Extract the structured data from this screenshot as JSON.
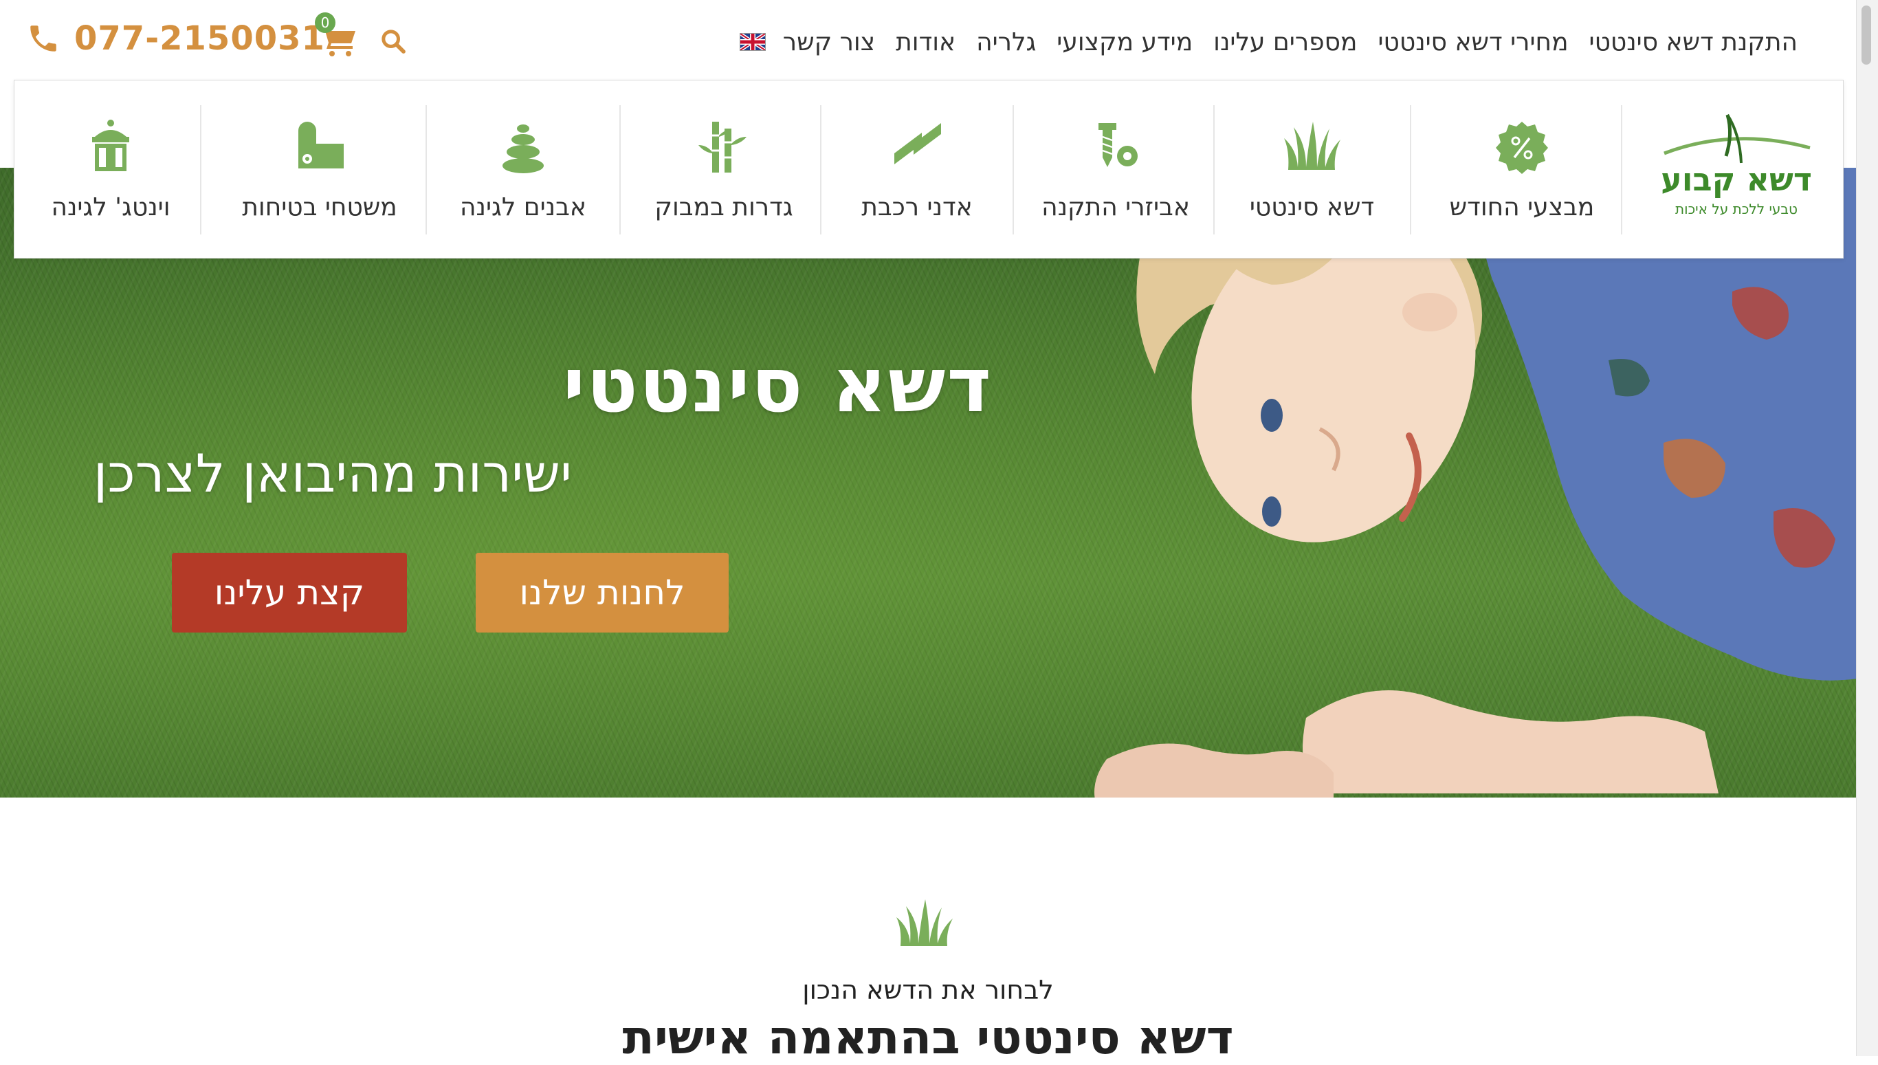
{
  "header": {
    "nav": [
      "התקנת דשא סינטטי",
      "מחירי דשא סינטטי",
      "מספרים עלינו",
      "מידע מקצועי",
      "גלריה",
      "אודות",
      "צור קשר"
    ],
    "phone": "077-2150031",
    "cart_count": "0",
    "language_icon": "uk-flag-icon"
  },
  "logo": {
    "name": "דשא קבוע",
    "tagline": "טבעי ללכת על איכות",
    "color": "#3d8a2a"
  },
  "categories": [
    {
      "label": "מבצעי החודש",
      "icon": "percent-badge-icon"
    },
    {
      "label": "דשא סינטטי",
      "icon": "grass-icon"
    },
    {
      "label": "אביזרי התקנה",
      "icon": "screw-nut-icon"
    },
    {
      "label": "אדני רכבת",
      "icon": "railway-sleeper-icon"
    },
    {
      "label": "גדרות במבוק",
      "icon": "bamboo-icon"
    },
    {
      "label": "אבנים לגינה",
      "icon": "stones-icon"
    },
    {
      "label": "משטחי בטיחות",
      "icon": "safety-mat-icon"
    },
    {
      "label": "וינטג' לגינה",
      "icon": "vintage-lantern-icon"
    }
  ],
  "hero": {
    "title": "דשא סינטטי",
    "subtitle": "ישירות מהיבואן לצרכן",
    "shop_button": "לחנות שלנו",
    "buy_button": "קצת עלינו"
  },
  "section": {
    "eyebrow": "לבחור את הדשא הנכון",
    "heading": "דשא סינטטי בהתאמה אישית"
  },
  "colors": {
    "accent_orange": "#d4903f",
    "accent_red": "#b43a27",
    "icon_green": "#7aae5a"
  }
}
